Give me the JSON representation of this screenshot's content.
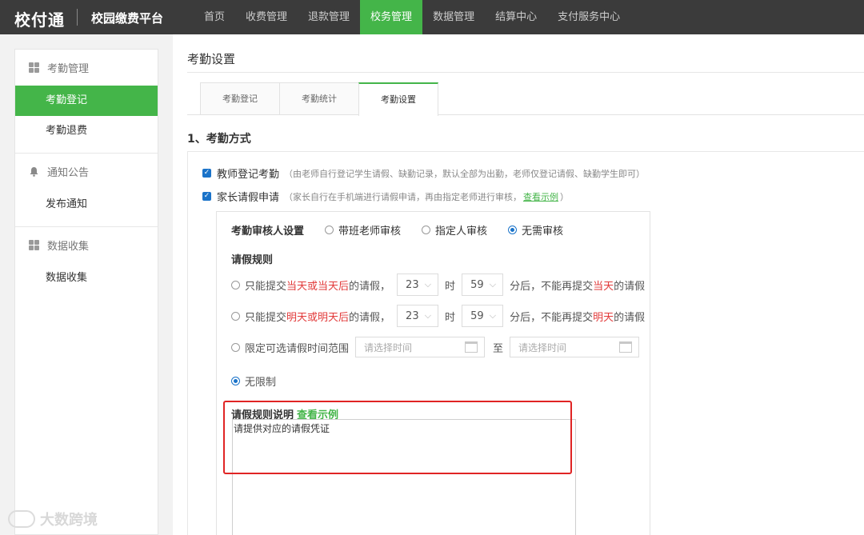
{
  "header": {
    "logo": "校付通",
    "platform": "校园缴费平台",
    "nav": [
      {
        "label": "首页",
        "active": false
      },
      {
        "label": "收费管理",
        "active": false
      },
      {
        "label": "退款管理",
        "active": false
      },
      {
        "label": "校务管理",
        "active": true
      },
      {
        "label": "数据管理",
        "active": false
      },
      {
        "label": "结算中心",
        "active": false
      },
      {
        "label": "支付服务中心",
        "active": false
      }
    ]
  },
  "sidebar": {
    "groups": [
      {
        "title": "考勤管理",
        "icon": "grid-icon",
        "items": [
          "考勤登记",
          "考勤退费"
        ]
      },
      {
        "title": "通知公告",
        "icon": "bell-icon",
        "items": [
          "发布通知"
        ]
      },
      {
        "title": "数据收集",
        "icon": "grid-icon",
        "items": [
          "数据收集"
        ]
      }
    ],
    "active_item": "考勤登记"
  },
  "main": {
    "page_title": "考勤设置",
    "tabs": [
      "考勤登记",
      "考勤统计",
      "考勤设置"
    ],
    "active_tab": "考勤设置",
    "section_title": "1、考勤方式",
    "method1": {
      "label": "教师登记考勤",
      "checked": true,
      "hint": "（由老师自行登记学生请假、缺勤记录，默认全部为出勤，老师仅登记请假、缺勤学生即可）"
    },
    "method2": {
      "label": "家长请假申请",
      "checked": true,
      "hint_pre": "（家长自行在手机端进行请假申请，再由指定老师进行审核，",
      "hint_link": "查看示例",
      "hint_post": "）"
    },
    "reviewer": {
      "label": "考勤审核人设置",
      "options": [
        "带班老师审核",
        "指定人审核",
        "无需审核"
      ],
      "selected": "无需审核"
    },
    "rules": {
      "title": "请假规则",
      "rule1": {
        "pre": "只能提交",
        "red": "当天或当天后",
        "mid": "的请假，",
        "hour": "23",
        "hour_unit": "时",
        "minute": "59",
        "post_pre": "分后，不能再提交",
        "post_red": "当天",
        "post_end": "的请假"
      },
      "rule2": {
        "pre": "只能提交",
        "red": "明天或明天后",
        "mid": "的请假，",
        "hour": "23",
        "hour_unit": "时",
        "minute": "59",
        "post_pre": "分后，不能再提交",
        "post_red": "明天",
        "post_end": "的请假"
      },
      "rule3": {
        "label": "限定可选请假时间范围",
        "start_placeholder": "请选择时间",
        "sep": "至",
        "end_placeholder": "请选择时间"
      },
      "rule4": {
        "label": "无限制"
      },
      "selected": "无限制"
    },
    "explain": {
      "title": "请假规则说明",
      "link": "查看示例",
      "value": "请提供对应的请假凭证"
    }
  },
  "watermark": "大数跨境",
  "colors": {
    "accent": "#44b549",
    "topbar": "#3b3b3b",
    "highlight": "#e02424",
    "check": "#1a73c9"
  }
}
